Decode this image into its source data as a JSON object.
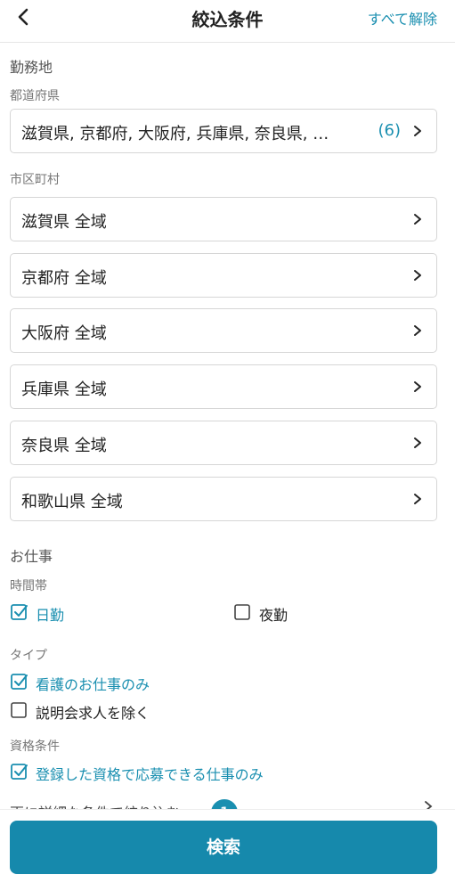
{
  "header": {
    "title": "絞込条件",
    "clear_all_label": "すべて解除"
  },
  "location": {
    "section_label": "勤務地",
    "prefecture_label": "都道府県",
    "prefecture_value": "滋賀県, 京都府, 大阪府, 兵庫県, 奈良県, …",
    "prefecture_count": "(6)",
    "city_label": "市区町村",
    "cities": [
      "滋賀県 全域",
      "京都府 全域",
      "大阪府 全域",
      "兵庫県 全域",
      "奈良県 全域",
      "和歌山県 全域"
    ]
  },
  "job": {
    "section_label": "お仕事",
    "time_label": "時間帯",
    "time_options": [
      {
        "label": "日勤",
        "checked": true
      },
      {
        "label": "夜勤",
        "checked": false
      }
    ],
    "type_label": "タイプ",
    "type_options": [
      {
        "label": "看護のお仕事のみ",
        "checked": true
      },
      {
        "label": "説明会求人を除く",
        "checked": false
      }
    ],
    "qual_label": "資格条件",
    "qual_options": [
      {
        "label": "登録した資格で応募できる仕事のみ",
        "checked": true
      }
    ]
  },
  "more": {
    "label": "更に詳細な条件で絞り込む",
    "badge_count": "1"
  },
  "search_button_label": "検索",
  "colors": {
    "accent": "#1a8fb0",
    "button": "#1689ac",
    "border": "#d6d6d6"
  }
}
